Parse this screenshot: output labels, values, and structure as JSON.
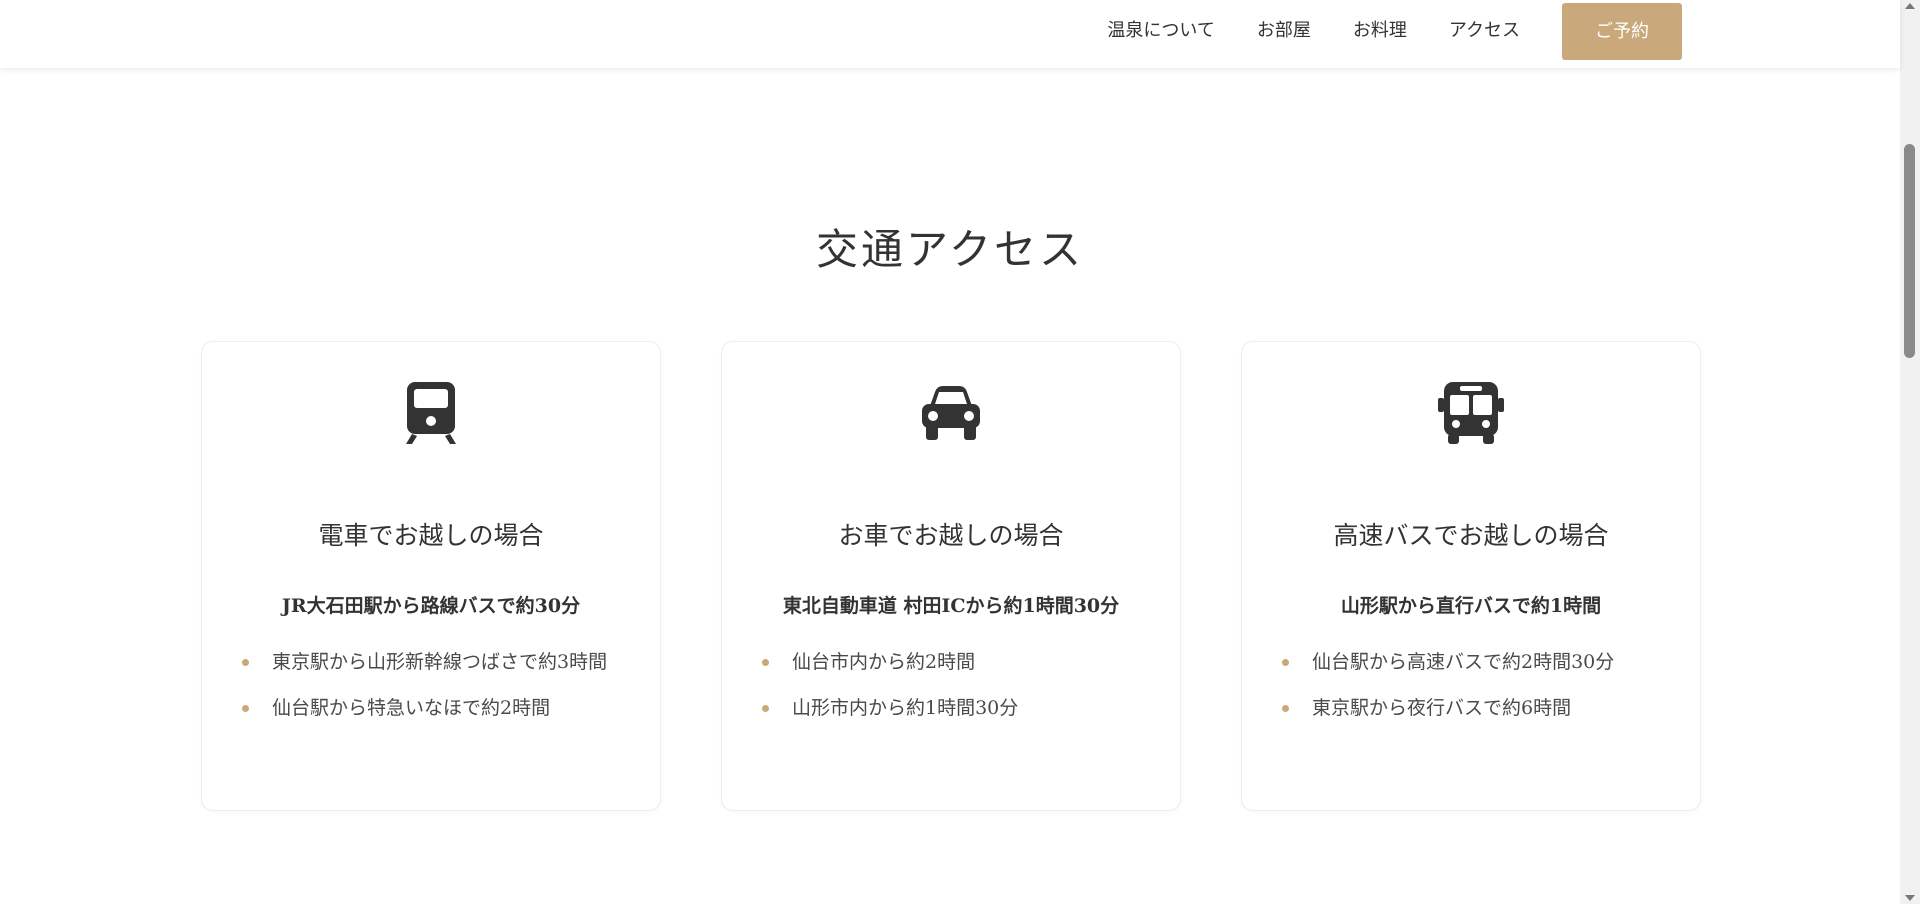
{
  "nav": {
    "items": [
      "温泉について",
      "お部屋",
      "お料理",
      "アクセス"
    ],
    "reserve_label": "ご予約"
  },
  "colors": {
    "accent": "#c9a87b",
    "text": "#333333"
  },
  "access": {
    "title": "交通アクセス",
    "cards": [
      {
        "icon": "train-icon",
        "title": "電車でお越しの場合",
        "subtitle": "JR大石田駅から路線バスで約30分",
        "items": [
          "東京駅から山形新幹線つばさで約3時間",
          "仙台駅から特急いなほで約2時間"
        ]
      },
      {
        "icon": "car-icon",
        "title": "お車でお越しの場合",
        "subtitle": "東北自動車道 村田ICから約1時間30分",
        "items": [
          "仙台市内から約2時間",
          "山形市内から約1時間30分"
        ]
      },
      {
        "icon": "bus-icon",
        "title": "高速バスでお越しの場合",
        "subtitle": "山形駅から直行バスで約1時間",
        "items": [
          "仙台駅から高速バスで約2時間30分",
          "東京駅から夜行バスで約6時間"
        ]
      }
    ]
  }
}
